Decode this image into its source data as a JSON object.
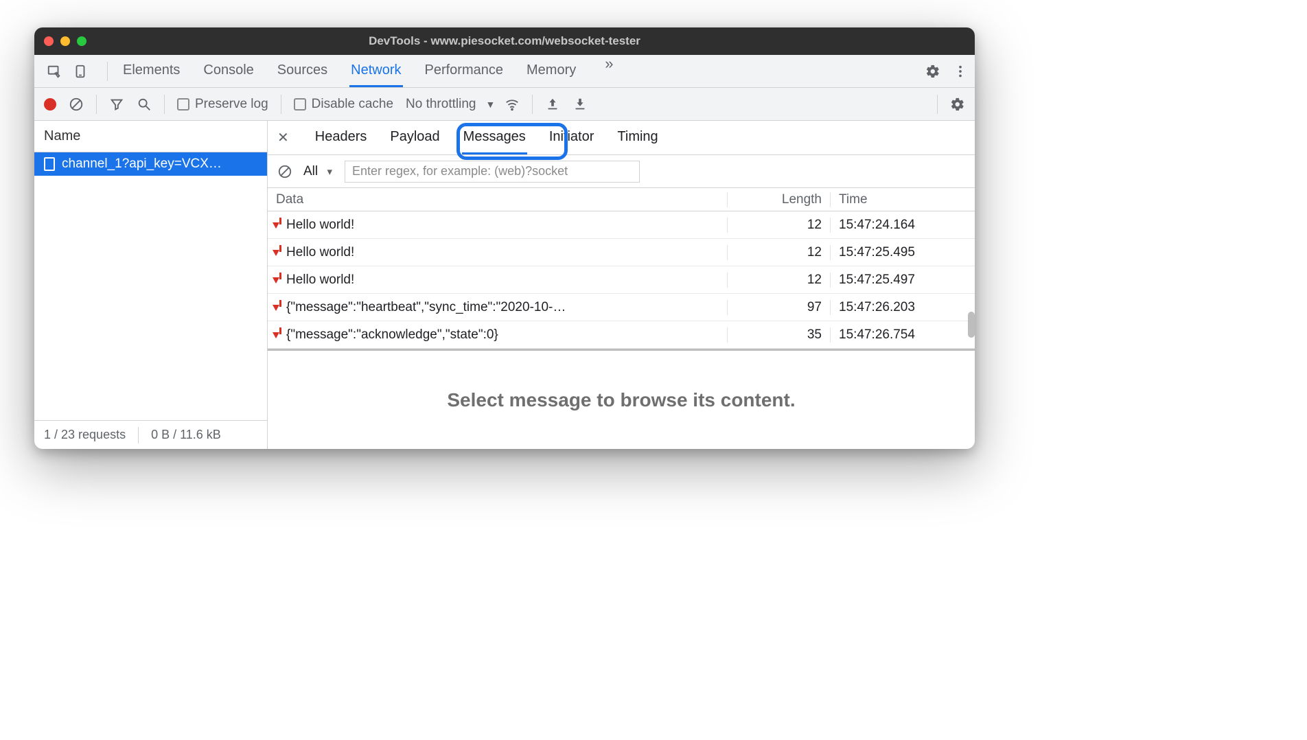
{
  "window": {
    "title": "DevTools - www.piesocket.com/websocket-tester"
  },
  "main_tabs": {
    "items": [
      "Elements",
      "Console",
      "Sources",
      "Network",
      "Performance",
      "Memory"
    ],
    "active_index": 3,
    "overflow": "»"
  },
  "toolbar": {
    "preserve_log": "Preserve log",
    "disable_cache": "Disable cache",
    "throttling": "No throttling"
  },
  "sidebar": {
    "header": "Name",
    "request_name": "channel_1?api_key=VCX…",
    "status_requests": "1 / 23 requests",
    "status_transfer": "0 B / 11.6 kB"
  },
  "detail_tabs": {
    "items": [
      "Headers",
      "Payload",
      "Messages",
      "Initiator",
      "Timing"
    ],
    "active_index": 2
  },
  "filterbar": {
    "type_selected": "All",
    "regex_placeholder": "Enter regex, for example: (web)?socket"
  },
  "messages": {
    "columns": {
      "data": "Data",
      "length": "Length",
      "time": "Time"
    },
    "rows": [
      {
        "dir": "down",
        "data": "Hello world!",
        "length": "12",
        "time": "15:47:24.164"
      },
      {
        "dir": "down",
        "data": "Hello world!",
        "length": "12",
        "time": "15:47:25.495"
      },
      {
        "dir": "down",
        "data": "Hello world!",
        "length": "12",
        "time": "15:47:25.497"
      },
      {
        "dir": "down",
        "data": "{\"message\":\"heartbeat\",\"sync_time\":\"2020-10-…",
        "length": "97",
        "time": "15:47:26.203"
      },
      {
        "dir": "down",
        "data": "{\"message\":\"acknowledge\",\"state\":0}",
        "length": "35",
        "time": "15:47:26.754"
      }
    ]
  },
  "placeholder": "Select message to browse its content."
}
